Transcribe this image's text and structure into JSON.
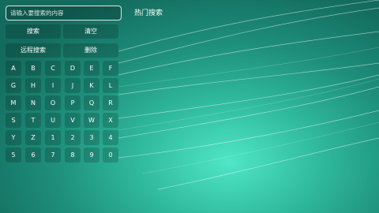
{
  "search": {
    "placeholder": "请输入要搜索的内容"
  },
  "hot": {
    "title": "热门搜索"
  },
  "actions": {
    "search": "搜索",
    "clear": "清空",
    "remote": "远程搜索",
    "delete": "删除"
  },
  "keys": [
    [
      "A",
      "B",
      "C",
      "D",
      "E",
      "F"
    ],
    [
      "G",
      "H",
      "I",
      "J",
      "K",
      "L"
    ],
    [
      "M",
      "N",
      "O",
      "P",
      "Q",
      "R"
    ],
    [
      "S",
      "T",
      "U",
      "V",
      "W",
      "X"
    ],
    [
      "Y",
      "Z",
      "1",
      "2",
      "3",
      "4"
    ],
    [
      "5",
      "6",
      "7",
      "8",
      "9",
      "0"
    ]
  ],
  "colors": {
    "bg_center": "#4fe6c6",
    "bg_edge": "#136b5d"
  }
}
